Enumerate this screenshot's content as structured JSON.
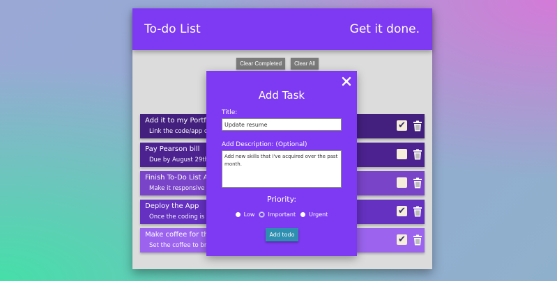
{
  "header": {
    "title": "To-do List",
    "tagline": "Get it done."
  },
  "controls": {
    "clear_completed": "Clear Completed",
    "clear_all": "Clear All"
  },
  "todos": [
    {
      "title": "Add it to my Portfol",
      "desc": "Link the code/app on",
      "checked": true,
      "color": "#43207e"
    },
    {
      "title": "Pay Pearson bill",
      "desc": "Due by August 29th!",
      "checked": false,
      "color": "#4c2290"
    },
    {
      "title": "Finish To-Do List Ap",
      "desc": "Make it responsive a",
      "checked": false,
      "color": "#7a44c8"
    },
    {
      "title": "Deploy the App",
      "desc": "Once the coding is fin",
      "checked": true,
      "color": "#6431c0"
    },
    {
      "title": "Make coffee for the",
      "desc": "Set the coffee to bre",
      "checked": true,
      "color": "#9c64ee"
    }
  ],
  "modal": {
    "heading": "Add Task",
    "title_label": "Title:",
    "title_value": "Update resume",
    "desc_label": "Add Description: (Optional)",
    "desc_value": "Add new skills that I've acquired over the past month.",
    "priority_label": "Priority:",
    "priorities": [
      "Low",
      "Important",
      "Urgent"
    ],
    "selected_priority": "Important",
    "add_button": "Add todo"
  },
  "colors": {
    "accent": "#7e3af2",
    "add_button": "#2e8fb0",
    "panel_bg": "#dcdcdc"
  }
}
